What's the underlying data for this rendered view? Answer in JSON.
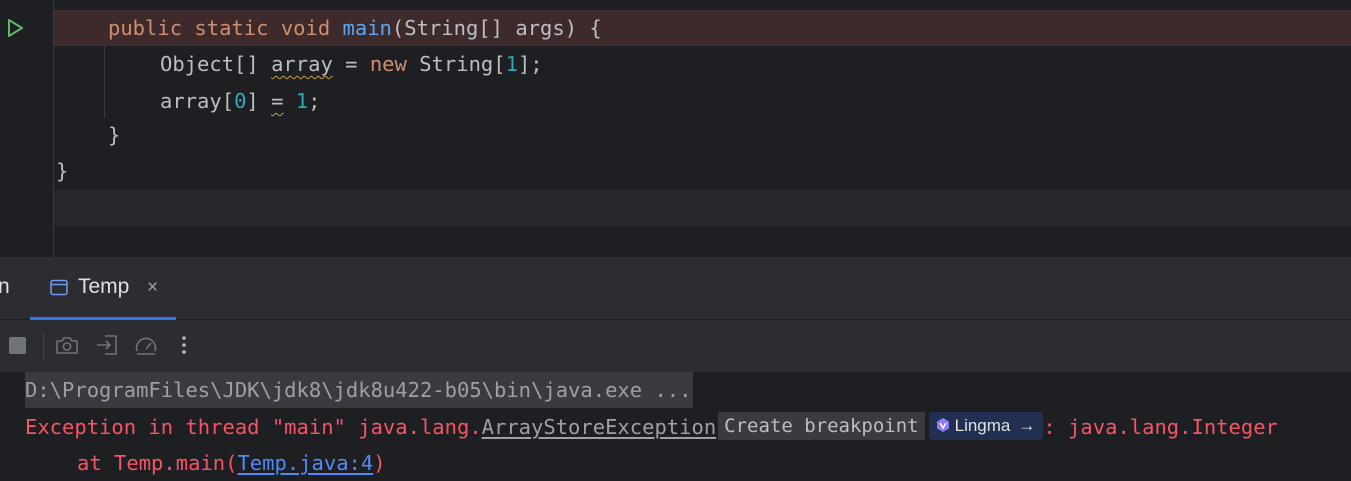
{
  "editor": {
    "lines": [
      {
        "parts": [
          "public",
          " ",
          "static",
          " ",
          "void",
          " ",
          "main",
          "(String[] args) {"
        ]
      },
      {
        "parts": [
          "Object[] ",
          "array",
          " = ",
          "new",
          " String[",
          "1",
          "];"
        ]
      },
      {
        "parts": [
          "array[",
          "0",
          "] ",
          "=",
          " ",
          "1",
          ";"
        ]
      },
      {
        "parts": [
          "}"
        ]
      },
      {
        "parts": [
          "}"
        ]
      }
    ]
  },
  "tool_window": {
    "prev_tab_fragment": "n",
    "tab_label": "Temp",
    "tab_close": "×"
  },
  "console": {
    "line1": "D:\\ProgramFiles\\JDK\\jdk8\\jdk8u422-b05\\bin\\java.exe ...",
    "line2_prefix": "Exception in thread \"main\" java.lang.",
    "exception_class": "ArrayStoreException",
    "create_breakpoint": "Create breakpoint",
    "lingma_label": "Lingma",
    "lingma_arrow": "→",
    "line2_suffix": ": java.lang.Integer",
    "line3_prefix": "at Temp.main(",
    "line3_link": "Temp.java:4",
    "line3_suffix": ")"
  },
  "colors": {
    "error_text": "#f75464",
    "link": "#548af7",
    "keyword": "#cf8e6d",
    "function": "#56a8f5",
    "number": "#2aacb8",
    "accent": "#3574f0"
  },
  "icons": {
    "gutter": "run-icon",
    "tab": "console-icon",
    "toolbar": [
      "stop-icon",
      "camera-icon",
      "import-icon",
      "gauge-icon",
      "more-icon"
    ],
    "lingma": "lingma-icon"
  }
}
